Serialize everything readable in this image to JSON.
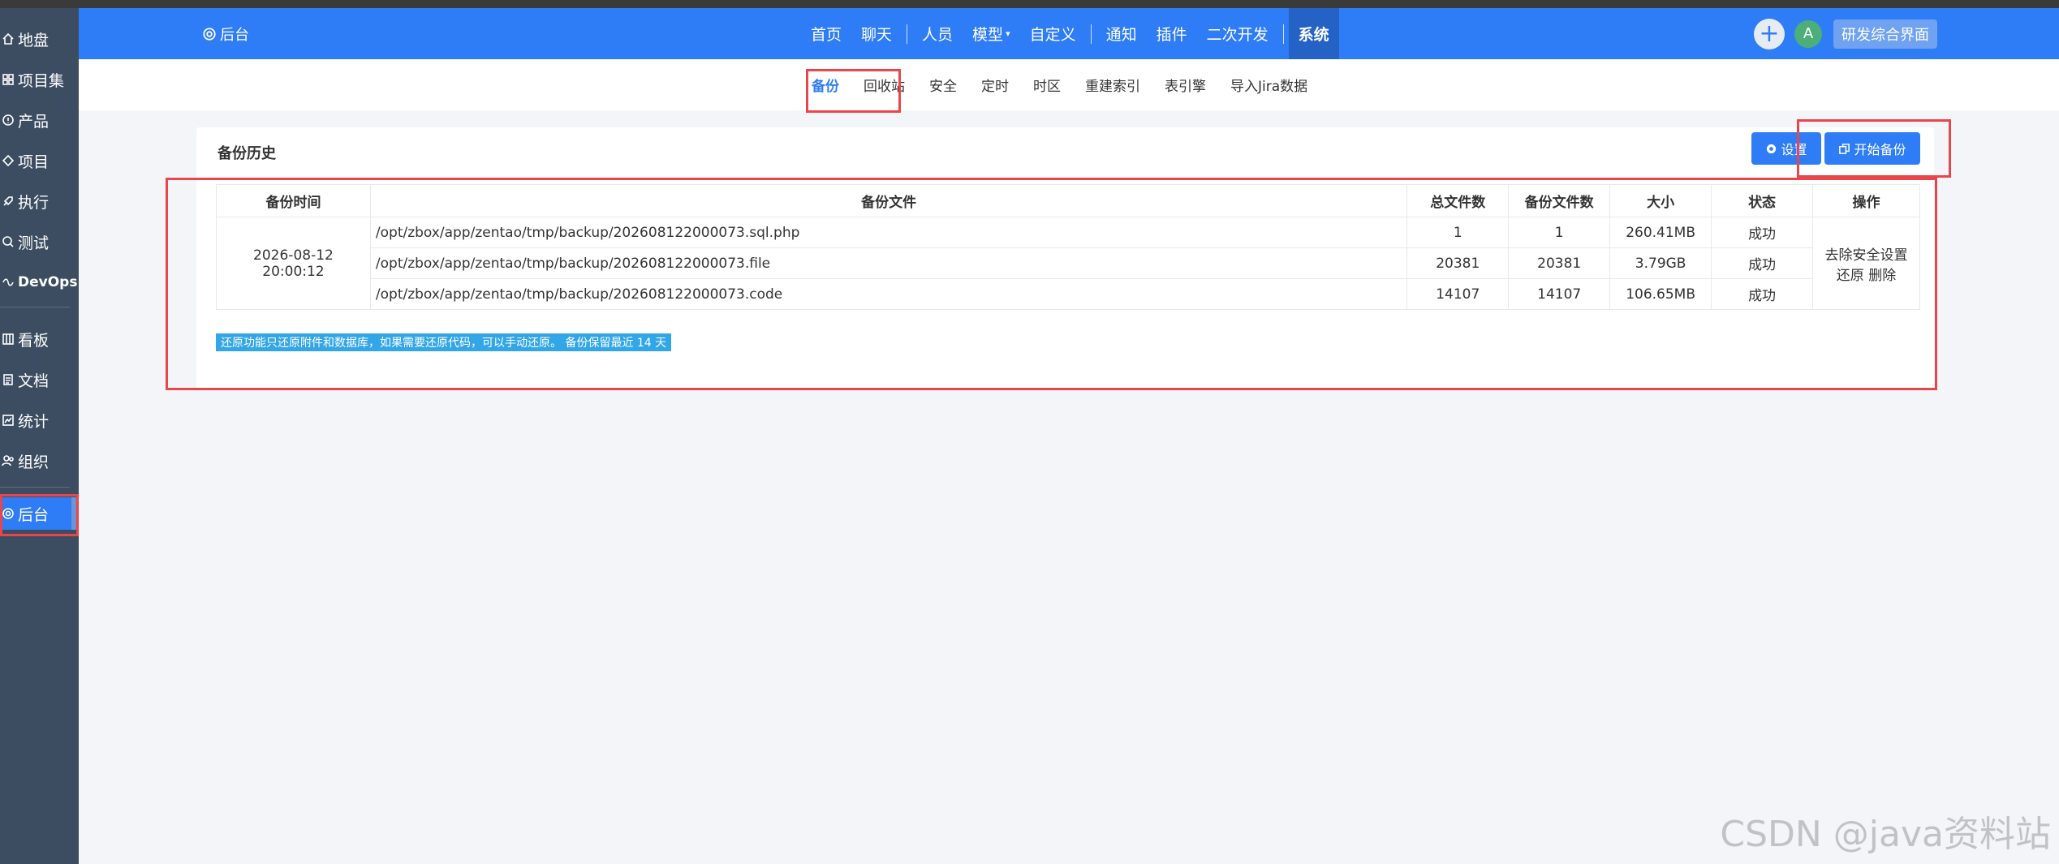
{
  "sidebar": {
    "items": [
      {
        "label": "地盘",
        "icon": "home-icon"
      },
      {
        "label": "项目集",
        "icon": "grid-icon"
      },
      {
        "label": "产品",
        "icon": "product-icon"
      },
      {
        "label": "项目",
        "icon": "project-icon"
      },
      {
        "label": "执行",
        "icon": "rocket-icon"
      },
      {
        "label": "测试",
        "icon": "test-icon"
      },
      {
        "label": "DevOps",
        "icon": "devops-icon"
      },
      {
        "label": "看板",
        "icon": "kanban-icon"
      },
      {
        "label": "文档",
        "icon": "doc-icon"
      },
      {
        "label": "统计",
        "icon": "chart-icon"
      },
      {
        "label": "组织",
        "icon": "org-icon"
      },
      {
        "label": "后台",
        "icon": "gear-icon"
      }
    ]
  },
  "header": {
    "brand": "后台",
    "nav": [
      "首页",
      "聊天",
      "人员",
      "模型",
      "自定义",
      "通知",
      "插件",
      "二次开发",
      "系统"
    ],
    "avatar": "A",
    "mode_button": "研发综合界面",
    "plus": "+"
  },
  "subnav": [
    "备份",
    "回收站",
    "安全",
    "定时",
    "时区",
    "重建索引",
    "表引擎",
    "导入Jira数据"
  ],
  "panel": {
    "title": "备份历史",
    "settings_label": "设置",
    "backup_label": "开始备份",
    "columns": [
      "备份时间",
      "备份文件",
      "总文件数",
      "备份文件数",
      "大小",
      "状态",
      "操作"
    ],
    "time": "2026-08-12 20:00:12",
    "rows": [
      {
        "file": "/opt/zbox/app/zentao/tmp/backup/202608122000073.sql.php",
        "total": "1",
        "count": "1",
        "size": "260.41MB",
        "status": "成功"
      },
      {
        "file": "/opt/zbox/app/zentao/tmp/backup/202608122000073.file",
        "total": "20381",
        "count": "20381",
        "size": "3.79GB",
        "status": "成功"
      },
      {
        "file": "/opt/zbox/app/zentao/tmp/backup/202608122000073.code",
        "total": "14107",
        "count": "14107",
        "size": "106.65MB",
        "status": "成功"
      }
    ],
    "actions": {
      "remove_security": "去除安全设置",
      "restore": "还原",
      "delete": "删除"
    },
    "notice": "还原功能只还原附件和数据库，如果需要还原代码，可以手动还原。 备份保留最近 14 天"
  },
  "watermark": "CSDN @java资料站",
  "colors": {
    "primary": "#2e7cf6",
    "sidebar": "#3c4d61",
    "highlight": "#e8464a",
    "notice": "#33a6e8"
  }
}
